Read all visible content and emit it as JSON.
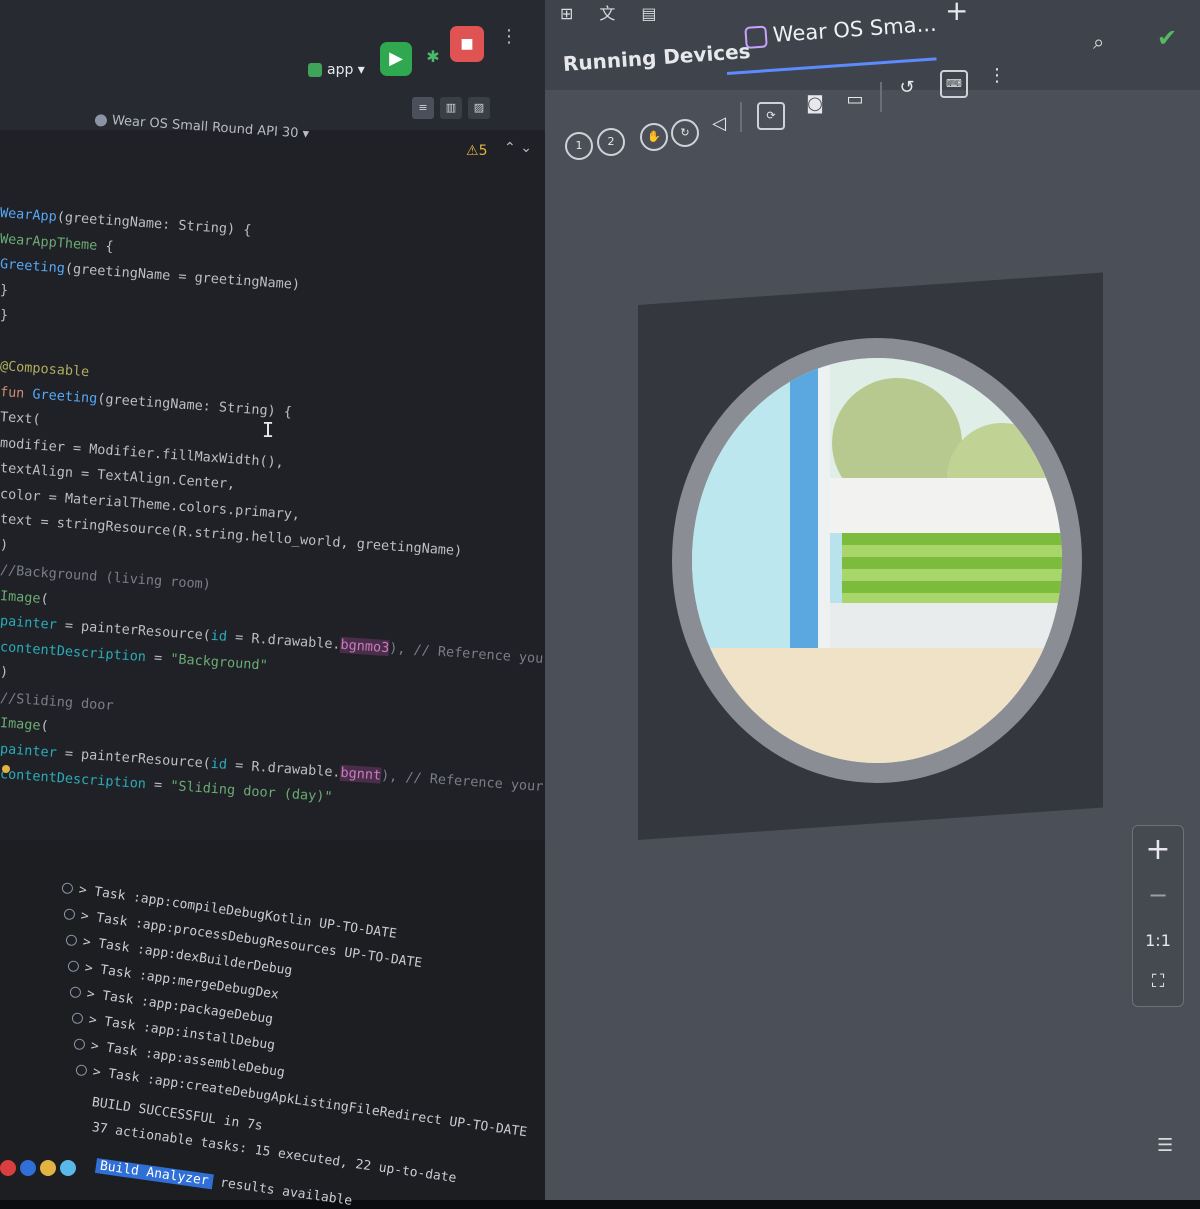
{
  "ide": {
    "device_selector": "Wear OS Small Round API 30",
    "run_config": "app",
    "warning_count": "5",
    "code_lines": [
      {
        "segments": [
          {
            "t": "WearApp",
            "c": "fn"
          },
          {
            "t": "(greetingName: String) {",
            "c": ""
          }
        ]
      },
      {
        "segments": [
          {
            "t": "    ",
            "c": ""
          },
          {
            "t": "WearAppTheme",
            "c": "ty"
          },
          {
            "t": " {",
            "c": ""
          }
        ]
      },
      {
        "segments": [
          {
            "t": "        ",
            "c": ""
          },
          {
            "t": "Greeting",
            "c": "fn"
          },
          {
            "t": "(greetingName = greetingName)",
            "c": ""
          }
        ]
      },
      {
        "segments": [
          {
            "t": "    }",
            "c": ""
          }
        ]
      },
      {
        "segments": [
          {
            "t": "}",
            "c": ""
          }
        ]
      },
      {
        "segments": [
          {
            "t": "",
            "c": ""
          }
        ]
      },
      {
        "segments": [
          {
            "t": "@Composable",
            "c": "an"
          }
        ]
      },
      {
        "segments": [
          {
            "t": "fun ",
            "c": "kw"
          },
          {
            "t": "Greeting",
            "c": "fn"
          },
          {
            "t": "(greetingName: String) {",
            "c": ""
          }
        ]
      },
      {
        "segments": [
          {
            "t": "    Text(",
            "c": ""
          }
        ]
      },
      {
        "segments": [
          {
            "t": "        modifier = Modifier.fillMaxWidth(),",
            "c": ""
          }
        ]
      },
      {
        "segments": [
          {
            "t": "        textAlign = TextAlign.Center,",
            "c": ""
          }
        ]
      },
      {
        "segments": [
          {
            "t": "        color = MaterialTheme.colors.primary,",
            "c": ""
          }
        ]
      },
      {
        "segments": [
          {
            "t": "        text = stringResource(R.string.hello_world, greetingName)",
            "c": ""
          }
        ]
      },
      {
        "segments": [
          {
            "t": "    )",
            "c": ""
          }
        ]
      },
      {
        "segments": [
          {
            "t": "    //Background (living room)",
            "c": "cm"
          }
        ]
      },
      {
        "segments": [
          {
            "t": "    ",
            "c": ""
          },
          {
            "t": "Image",
            "c": "ty"
          },
          {
            "t": "(",
            "c": ""
          }
        ]
      },
      {
        "segments": [
          {
            "t": "        ",
            "c": ""
          },
          {
            "t": "painter",
            "c": "tl"
          },
          {
            "t": " = painterResource(",
            "c": ""
          },
          {
            "t": "id",
            "c": "nm"
          },
          {
            "t": " = R.drawable.",
            "c": ""
          },
          {
            "t": "bgnmo3",
            "c": "pk"
          },
          {
            "t": "), // Reference your image",
            "c": "cm"
          }
        ]
      },
      {
        "segments": [
          {
            "t": "        ",
            "c": ""
          },
          {
            "t": "contentDescription",
            "c": "tl"
          },
          {
            "t": " = ",
            "c": ""
          },
          {
            "t": "\"Background\"",
            "c": "st"
          }
        ]
      },
      {
        "segments": [
          {
            "t": "    )",
            "c": ""
          }
        ]
      },
      {
        "segments": [
          {
            "t": "    //Sliding door",
            "c": "cm"
          }
        ]
      },
      {
        "segments": [
          {
            "t": "    ",
            "c": ""
          },
          {
            "t": "Image",
            "c": "ty"
          },
          {
            "t": "(",
            "c": ""
          }
        ]
      },
      {
        "segments": [
          {
            "t": "        ",
            "c": ""
          },
          {
            "t": "painter",
            "c": "tl"
          },
          {
            "t": " = painterResource(",
            "c": ""
          },
          {
            "t": "id",
            "c": "nm"
          },
          {
            "t": " = R.drawable.",
            "c": ""
          },
          {
            "t": "bgnnt",
            "c": "pk"
          },
          {
            "t": "), // Reference your image",
            "c": "cm"
          }
        ]
      },
      {
        "segments": [
          {
            "t": "        ",
            "c": ""
          },
          {
            "t": "contentDescription",
            "c": "tl"
          },
          {
            "t": " = ",
            "c": ""
          },
          {
            "t": "\"Sliding door (day)\"",
            "c": "st"
          }
        ]
      }
    ],
    "console_lines": [
      "> Task :app:compileDebugKotlin UP-TO-DATE",
      "> Task :app:processDebugResources UP-TO-DATE",
      "> Task :app:dexBuilderDebug",
      "> Task :app:mergeDebugDex",
      "> Task :app:packageDebug",
      "> Task :app:installDebug",
      "> Task :app:assembleDebug",
      "> Task :app:createDebugApkListingFileRedirect UP-TO-DATE"
    ],
    "build_result": "BUILD SUCCESSFUL in 7s",
    "build_summary": "37 actionable tasks: 15 executed, 22 up-to-date",
    "build_analyzer": "Build Analyzer",
    "build_analyzer_suffix": "results available"
  },
  "running_devices": {
    "title": "Running Devices",
    "tab_label": "Wear OS Sma...",
    "zoom_in": "+",
    "zoom_out": "−",
    "zoom_actual": "1:1"
  },
  "colors": {
    "run": "#2fa84f",
    "stop": "#e05353",
    "accent_tab": "#5d8bff",
    "check": "#56b85f"
  }
}
